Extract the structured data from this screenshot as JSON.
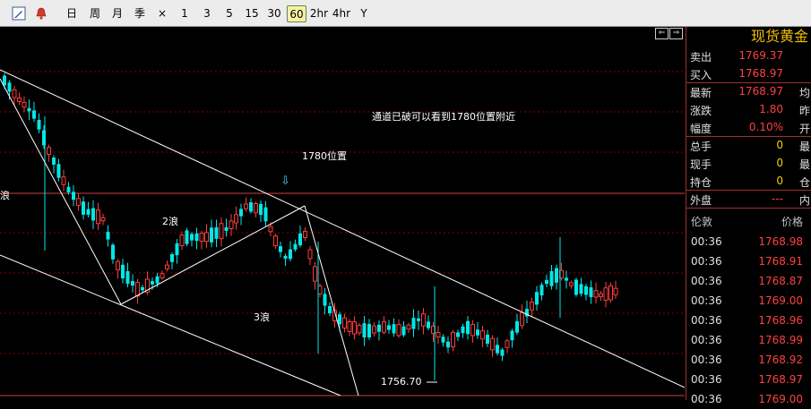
{
  "toolbar": {
    "items": [
      "日",
      "周",
      "月",
      "季",
      "×",
      "1",
      "3",
      "5",
      "15",
      "30",
      "60",
      "2hr",
      "4hr",
      "Y"
    ],
    "active": "60"
  },
  "chart": {
    "annotations": {
      "channel_note": "通道已破可以看到1780位置附近",
      "target": "1780位置",
      "arrow": "⇩",
      "wave2": "2浪",
      "wave3": "3浪",
      "wave_left": "浪",
      "low_label": "1756.70"
    },
    "nav": [
      "⇐",
      "⇒"
    ],
    "colors": {
      "up": "#ff3c3c",
      "down": "#00e8e8",
      "line": "#ffffff",
      "grid": "#8a0000"
    }
  },
  "quote": {
    "title": "现货黄金",
    "rows": [
      {
        "label": "卖出",
        "value": "1769.37",
        "color": "#ff4040",
        "right": ""
      },
      {
        "label": "买入",
        "value": "1768.97",
        "color": "#ff4040",
        "right": ""
      },
      {
        "label": "最新",
        "value": "1768.97",
        "color": "#ff4040",
        "right": "均"
      },
      {
        "label": "涨跌",
        "value": "1.80",
        "color": "#ff4040",
        "right": "昨"
      },
      {
        "label": "幅度",
        "value": "0.10%",
        "color": "#ff4040",
        "right": "开"
      },
      {
        "label": "总手",
        "value": "0",
        "color": "#f0d000",
        "right": "最"
      },
      {
        "label": "现手",
        "value": "0",
        "color": "#f0d000",
        "right": "最"
      },
      {
        "label": "持仓",
        "value": "0",
        "color": "#f0d000",
        "right": "仓"
      },
      {
        "label": "外盘",
        "value": "---",
        "color": "#ff4040",
        "right": "内"
      }
    ],
    "trade_header": {
      "time": "伦敦",
      "price": "价格"
    },
    "trades": [
      {
        "time": "00:36",
        "price": "1768.98"
      },
      {
        "time": "00:36",
        "price": "1768.91"
      },
      {
        "time": "00:36",
        "price": "1768.87"
      },
      {
        "time": "00:36",
        "price": "1769.00"
      },
      {
        "time": "00:36",
        "price": "1768.96"
      },
      {
        "time": "00:36",
        "price": "1768.99"
      },
      {
        "time": "00:36",
        "price": "1768.92"
      },
      {
        "time": "00:36",
        "price": "1768.97"
      },
      {
        "time": "00:36",
        "price": "1769.00"
      }
    ]
  }
}
